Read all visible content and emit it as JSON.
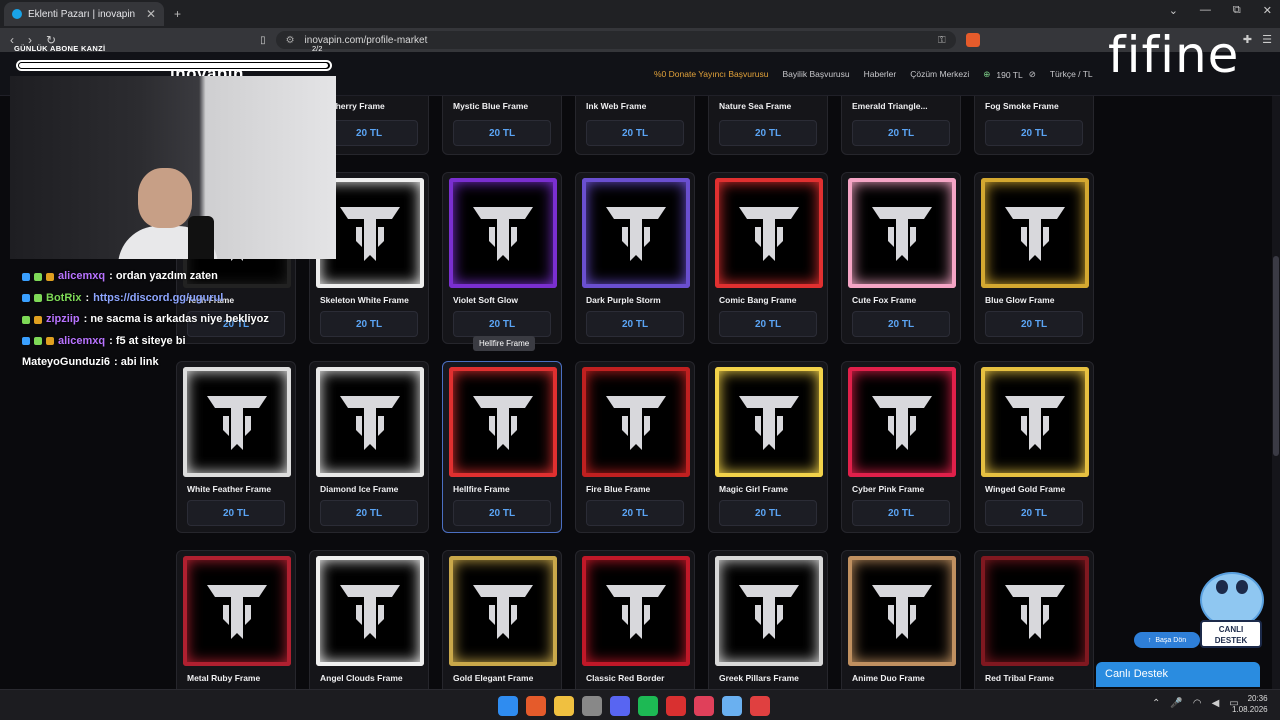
{
  "browser": {
    "tab_title": "Eklenti Pazarı | inovapin",
    "tab_close": "✕",
    "new_tab": "+",
    "url": "inovapin.com/profile-market",
    "window_controls": {
      "menu": "⌄",
      "minimize": "—",
      "maximize": "⧉",
      "close": "✕"
    }
  },
  "site": {
    "logo": "inovapin",
    "nav": {
      "donate": "%0 Donate Yayıncı Başvurusu",
      "dealer": "Bayilik Başvurusu",
      "news": "Haberler",
      "solutions": "Çözüm Merkezi",
      "balance": "190 TL",
      "language": "Türkçe / TL"
    }
  },
  "market": {
    "price_label": "20 TL",
    "tooltip": "Hellfire Frame",
    "row1": [
      "al Cherry Frame",
      "Mystic Blue Frame",
      "Ink Web Frame",
      "Nature Sea Frame",
      "Emerald Triangle...",
      "Fog Smoke Frame"
    ],
    "row2": [
      "Tech Frame",
      "Skeleton White Frame",
      "Violet Soft Glow",
      "Dark Purple Storm",
      "Comic Bang Frame",
      "Cute Fox Frame",
      "Blue Glow Frame"
    ],
    "row3": [
      "White Feather Frame",
      "Diamond Ice Frame",
      "Hellfire Frame",
      "Fire Blue Frame",
      "Magic Girl Frame",
      "Cyber Pink Frame",
      "Winged Gold Frame"
    ],
    "row4": [
      "Metal Ruby Frame",
      "Angel Clouds Frame",
      "Gold Elegant Frame",
      "Classic Red Border",
      "Greek Pillars Frame",
      "Anime Duo Frame",
      "Red Tribal Frame"
    ],
    "frame_colors": {
      "row2": [
        "#222",
        "#eee",
        "#7a2fd0",
        "#6a4fd0",
        "#e03030",
        "#f5a5c5",
        "#d4a830"
      ],
      "row3": [
        "#ddd",
        "#e8e8e8",
        "#e03030",
        "#c02020",
        "#f2d24a",
        "#e0204a",
        "#e6c040"
      ],
      "row4": [
        "#b02030",
        "#f0f0f0",
        "#c9a84a",
        "#c01828",
        "#d8d8d8",
        "#c09060",
        "#801820"
      ]
    }
  },
  "overlay": {
    "sub_goal": "GÜNLÜK ABONE KANZİ",
    "sub_count": "2/2",
    "sub_progress": 0.996,
    "brand": "fifine",
    "chat": [
      {
        "user": "alicemxq",
        "msg": " : ordan yazdım zaten"
      },
      {
        "user": "BotRix",
        "msg": " : ",
        "link": "https://discord.gg/ugurul"
      },
      {
        "user": "zipziip",
        "msg": " : ne sacma is arkadas niye bekliyoz"
      },
      {
        "user": "alicemxq",
        "msg": " : f5 at siteye bi"
      },
      {
        "user": "MateyoGunduzi6",
        "msg": " : abi link"
      }
    ]
  },
  "support": {
    "mascot_sign": "CANLI DESTEK",
    "back_to_top": "Başa Dön",
    "live_chat": "Canlı Destek"
  },
  "taskbar": {
    "time": "20:36",
    "date": "1.08.2026",
    "icon_colors": [
      "#2f8cf0",
      "#e55b2b",
      "#f0c040",
      "#888",
      "#5865f2",
      "#1db954",
      "#d93030",
      "#e0405a",
      "#6ab0f0",
      "#e04040"
    ]
  }
}
